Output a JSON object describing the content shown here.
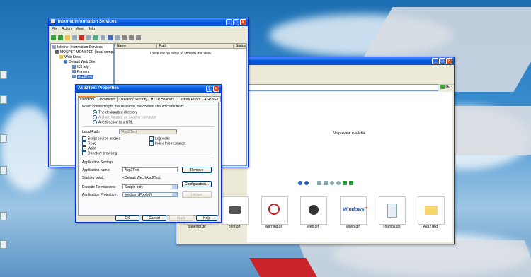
{
  "iis": {
    "title": "Internet Information Services",
    "menu": [
      "File",
      "Action",
      "View",
      "Help"
    ],
    "columns": [
      "Name",
      "Path",
      "Status"
    ],
    "empty_message": "There are no items to show in this view.",
    "tree": [
      "Internet Information Services",
      "MOSPET MONSTER (local compu",
      "Web Sites",
      "Default Web Site",
      "IISHelp",
      "Printers",
      "Asp2Text"
    ]
  },
  "dialog": {
    "title": "Asp2Text Properties",
    "tabs": [
      "Directory",
      "Documents",
      "Directory Security",
      "HTTP Headers",
      "Custom Errors",
      "ASP.NET"
    ],
    "intro": "When connecting to this resource, the content should come from:",
    "radios": [
      "The designated directory",
      "A share located on another computer",
      "A redirection to a URL"
    ],
    "local_path_label": "Local Path:",
    "local_path_value": "\\Asp2Text",
    "checks_left": [
      "Script source access",
      "Read",
      "Write",
      "Directory browsing"
    ],
    "checks_right": [
      "Log visits",
      "Index this resource"
    ],
    "app_settings_label": "Application Settings",
    "app_name_label": "Application name:",
    "app_name_value": "Asp2Text",
    "starting_point_label": "Starting point:",
    "starting_point_value": "<Default We...\\Asp2Text",
    "exec_perm_label": "Execute Permissions:",
    "exec_perm_value": "Scripts only",
    "app_protect_label": "Application Protection:",
    "app_protect_value": "Medium (Pooled)",
    "remove_btn": "Remove",
    "config_btn": "Configuration...",
    "unload_btn": "Unload",
    "ok_btn": "OK",
    "cancel_btn": "Cancel",
    "apply_btn": "Apply",
    "help_btn": "Help"
  },
  "explorer": {
    "preview_text": "No preview available.",
    "go_label": "Go",
    "thumbnails": [
      "pagerror.gif",
      "print.gif",
      "warning.gif",
      "web.gif",
      "winxp.gif",
      "Thumbs.db",
      "Asp2Text"
    ]
  }
}
